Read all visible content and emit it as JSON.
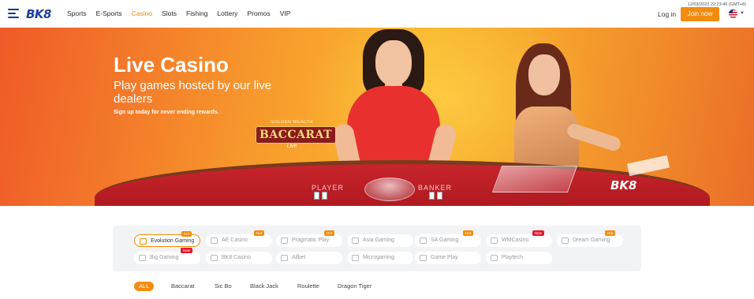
{
  "header": {
    "logo": "BK8",
    "nav": [
      "Sports",
      "E-Sports",
      "Casino",
      "Slots",
      "Fishing",
      "Lottery",
      "Promos",
      "VIP"
    ],
    "active_nav": "Casino",
    "datetime": "12/03/2023 22:23:46 (GMT+8)",
    "login_label": "Log in",
    "join_label": "Join now",
    "language_icon": "us-flag-icon"
  },
  "banner": {
    "title": "Live Casino",
    "subtitle": "Play games hosted by our live dealers",
    "tagline": "Sign up today for never ending rewards.",
    "game_logo_top": "GOLDEN WEALTH",
    "game_logo_main": "BACCARAT",
    "game_logo_sub": "Live",
    "table_print_player": "PLAYER",
    "table_print_banker": "BANKER",
    "watermark": "BK8"
  },
  "providers": [
    {
      "name": "Evolution Gaming",
      "tag": "hot",
      "selected": true
    },
    {
      "name": "AE Casino",
      "tag": "hot",
      "selected": false
    },
    {
      "name": "Pragmatic Play",
      "tag": "hot",
      "selected": false
    },
    {
      "name": "Asia Gaming",
      "tag": "",
      "selected": false
    },
    {
      "name": "SA Gaming",
      "tag": "hot",
      "selected": false
    },
    {
      "name": "WMCasino",
      "tag": "new",
      "selected": false
    },
    {
      "name": "Dream Gaming",
      "tag": "hot",
      "selected": false
    },
    {
      "name": "Big Gaming",
      "tag": "new",
      "selected": false
    },
    {
      "name": "BK8 Casino",
      "tag": "",
      "selected": false
    },
    {
      "name": "Allbet",
      "tag": "",
      "selected": false
    },
    {
      "name": "Microgaming",
      "tag": "",
      "selected": false
    },
    {
      "name": "Game Play",
      "tag": "",
      "selected": false
    },
    {
      "name": "Playtech",
      "tag": "",
      "selected": false
    }
  ],
  "tag_labels": {
    "hot": "Hot",
    "new": "New"
  },
  "categories": [
    "ALL",
    "Baccarat",
    "Sic Bo",
    "Black Jack",
    "Roulette",
    "Dragon Tiger"
  ],
  "active_category": "ALL",
  "colors": {
    "accent": "#f28c0f",
    "brand": "#1e3f9e",
    "new_tag": "#e5162f"
  }
}
